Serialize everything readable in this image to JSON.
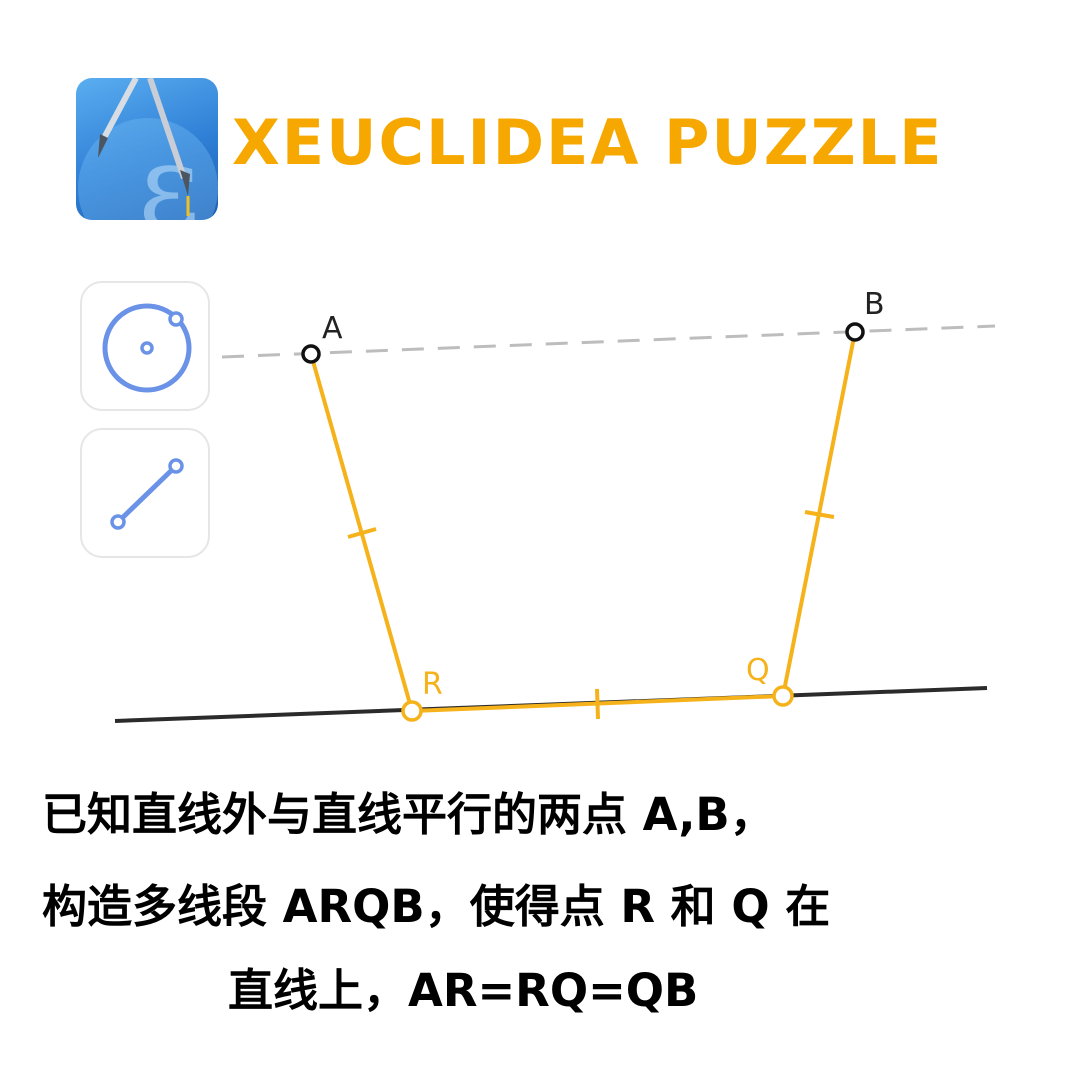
{
  "header": {
    "title": "XEUCLIDEA PUZZLE",
    "app_icon": "euclidea-compass-icon"
  },
  "toolbar": {
    "tools": [
      {
        "name": "circle-tool",
        "icon": "circle-tool-icon",
        "color": "#6a93e8"
      },
      {
        "name": "line-tool",
        "icon": "segment-tool-icon",
        "color": "#6a93e8"
      }
    ]
  },
  "diagram": {
    "labels": {
      "A": "A",
      "B": "B",
      "R": "R",
      "Q": "Q"
    },
    "colors": {
      "segment": "#f5b21a",
      "given_line": "#2b2b2b",
      "parallel_line": "#bdbdbd",
      "point_given": "#111111",
      "point_constructed": "#f5b21a",
      "label_given": "#222222",
      "label_constructed": "#f5b21a"
    }
  },
  "caption": {
    "line1": "已知直线外与直线平行的两点 A,B，",
    "line2": "构造多线段 ARQB，使得点 R 和 Q 在",
    "line3": "直线上，AR=RQ=QB"
  }
}
